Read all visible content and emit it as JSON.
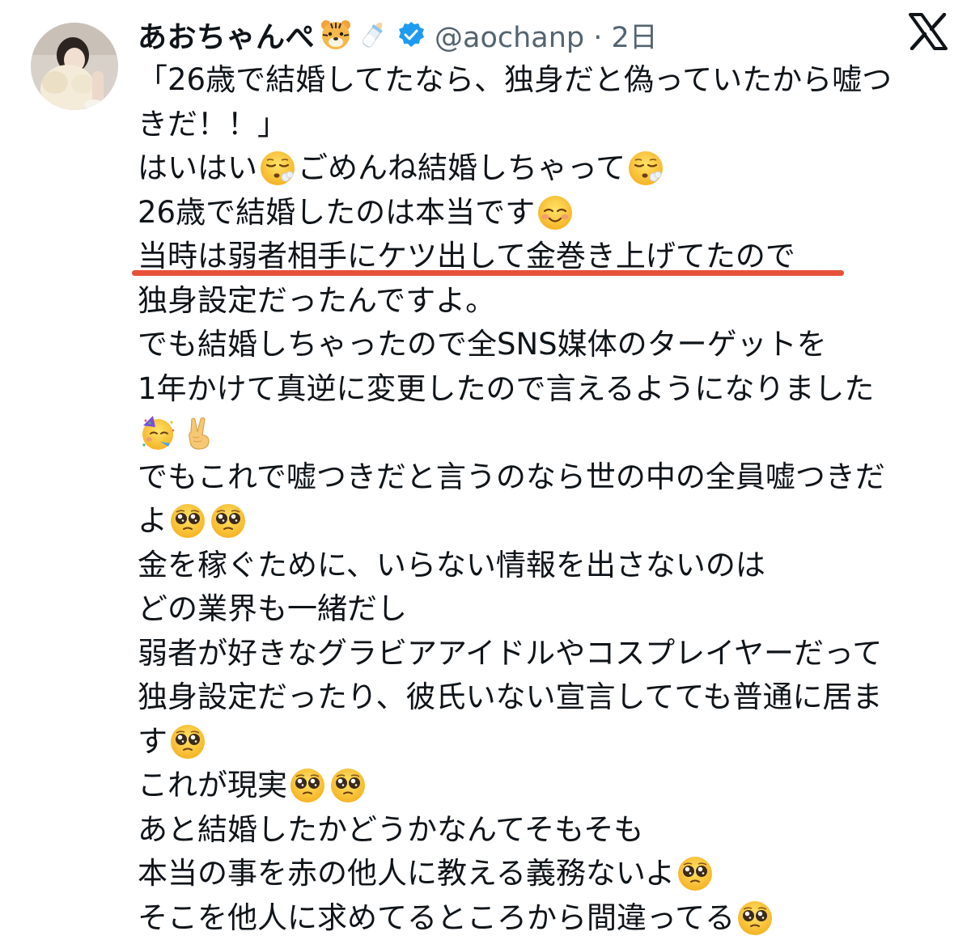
{
  "colors": {
    "text": "#0f1419",
    "secondary": "#536471",
    "verified": "#1d9bf0",
    "underline": "#e8503a"
  },
  "header": {
    "display_name": "あおちゃんぺ",
    "name_emojis": [
      "tiger-face-icon",
      "baby-bottle-icon"
    ],
    "verified_icon": "verified-badge-icon",
    "handle_and_time": "@aochanp · 2日",
    "brand_icon": "x-logo-icon"
  },
  "post": {
    "lines": [
      {
        "text": "「26歳で結婚してたなら、独身だと偽っていたから嘘つ"
      },
      {
        "text": "きだ！！」"
      },
      {
        "text_a": "はいはい",
        "emoji_a": "face-exhaling-icon",
        "text_b": "ごめんね結婚しちゃって",
        "emoji_b": "face-exhaling-icon"
      },
      {
        "text_a": "26歳で結婚したのは本当です",
        "emoji_a": "smiling-face-icon"
      },
      {
        "text": "当時は弱者相手にケツ出して金巻き上げてたので",
        "highlighted": true
      },
      {
        "text": "独身設定だったんですよ。"
      },
      {
        "text": "でも結婚しちゃったので全SNS媒体のターゲットを"
      },
      {
        "text": "1年かけて真逆に変更したので言えるようになりました"
      },
      {
        "emoji_a": "partying-face-icon",
        "emoji_b": "victory-hand-icon"
      },
      {
        "text": "でもこれで嘘つきだと言うのなら世の中の全員嘘つきだ"
      },
      {
        "text_a": "よ",
        "emoji_a": "pleading-face-icon",
        "emoji_b": "pleading-face-icon"
      },
      {
        "text": "金を稼ぐために、いらない情報を出さないのは"
      },
      {
        "text": "どの業界も一緒だし"
      },
      {
        "text": "弱者が好きなグラビアアイドルやコスプレイヤーだって"
      },
      {
        "text": "独身設定だったり、彼氏いない宣言してても普通に居ま"
      },
      {
        "text_a": "す",
        "emoji_a": "pleading-face-icon"
      },
      {
        "text_a": "これが現実",
        "emoji_a": "pleading-face-icon",
        "emoji_b": "pleading-face-icon"
      },
      {
        "text": "あと結婚したかどうかなんてそもそも"
      },
      {
        "text_a": "本当の事を赤の他人に教える義務ないよ",
        "emoji_a": "pleading-face-icon"
      },
      {
        "text_a": "そこを他人に求めてるところから間違ってる",
        "emoji_a": "pleading-face-icon"
      }
    ]
  }
}
